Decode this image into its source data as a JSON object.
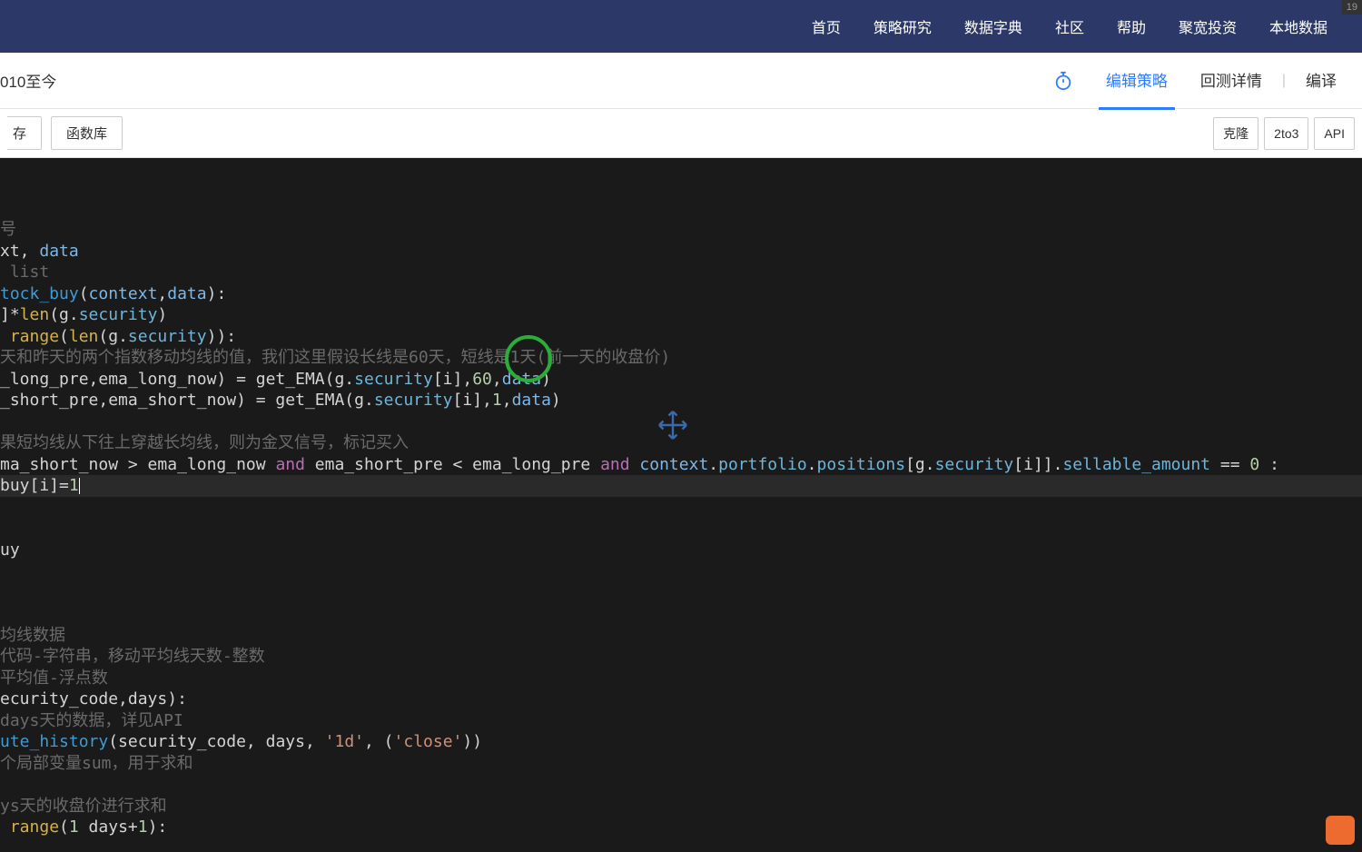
{
  "nav": {
    "items": [
      "首页",
      "策略研究",
      "数据字典",
      "社区",
      "帮助",
      "聚宽投资",
      "本地数据"
    ]
  },
  "corner_badge": "19",
  "subbar": {
    "title": "010至今",
    "tabs": {
      "edit": "编辑策略",
      "backtest": "回测详情",
      "compile": "编译"
    }
  },
  "toolbar": {
    "left": {
      "partial": "存",
      "funclib": "函数库"
    },
    "right": {
      "clone": "克隆",
      "to3": "2to3",
      "api": "API"
    }
  },
  "code": {
    "l1": "号",
    "l2a": "xt, ",
    "l2b": "data",
    "l3": " list",
    "l4_fn": "tock_buy",
    "l4_p1": "context",
    "l4_p2": "data",
    "l5_len": "len",
    "l5_sec": "security",
    "l6_range": "range",
    "l6_len": "len",
    "l6_sec": "security",
    "l7": "天和昨天的两个指数移动均线的值，我们这里假设长线是60天，短线是1天(前一天的收盘价)",
    "l8a": "_long_pre,ema_long_now) = get_EMA(g.",
    "l8b": "security",
    "l8c": "[i],",
    "l8n": "60",
    "l8d": ",",
    "l8e": "data",
    "l8f": ")",
    "l9a": "_short_pre,ema_short_now) = get_EMA(g.",
    "l9b": "security",
    "l9c": "[i],",
    "l9n": "1",
    "l9d": ",",
    "l9e": "data",
    "l9f": ")",
    "l10": "果短均线从下往上穿越长均线，则为金叉信号，标记买入",
    "l11_a": "ma_short_now > ema_long_now ",
    "l11_and1": "and",
    "l11_b": " ema_short_pre < ema_long_pre ",
    "l11_and2": "and",
    "l11_c": " ",
    "l11_ctx": "context",
    "l11_d": ".",
    "l11_pf": "portfolio",
    "l11_e": ".",
    "l11_pos": "positions",
    "l11_f": "[g.",
    "l11_sec": "security",
    "l11_g": "[i]].",
    "l11_sa": "sellable_amount",
    "l11_h": " == ",
    "l11_zero": "0",
    "l11_i": " :",
    "l12a": "buy[i]",
    "l12b": "=",
    "l12c": "1",
    "l13": "uy",
    "l14": "均线数据",
    "l15": "代码-字符串，移动平均线天数-整数",
    "l16": "平均值-浮点数",
    "l17a": "ecurity_code,days):",
    "l18a": "days天的数据，详见API",
    "l19a": "ute_history",
    "l19b": "(security_code, days, ",
    "l19s1": "'1d'",
    "l19c": ", (",
    "l19s2": "'close'",
    "l19d": "))",
    "l20": "个局部变量sum，用于求和",
    "l21": "ys天的收盘价进行求和",
    "l22a": "range",
    "l22b": "(",
    "l22c": "1",
    "l22d": " days+",
    "l22e": "1",
    "l22f": "):"
  }
}
